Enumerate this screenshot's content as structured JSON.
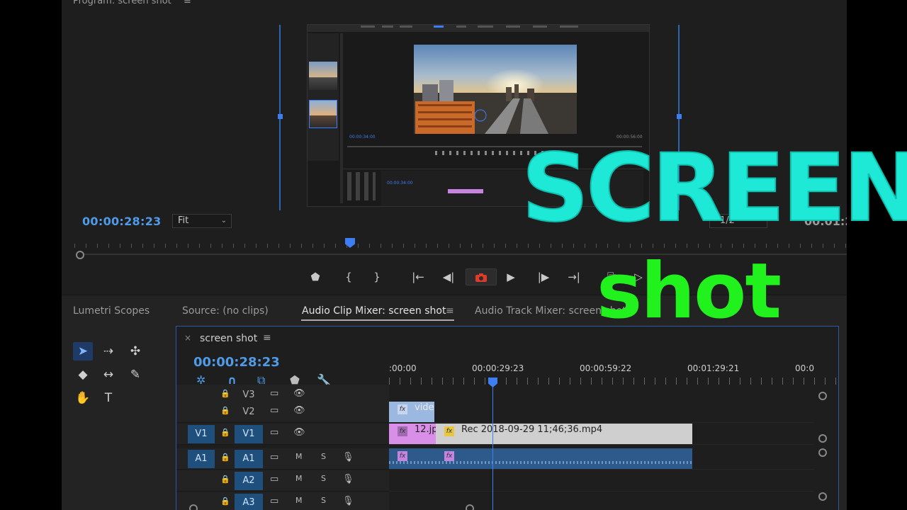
{
  "program_monitor": {
    "title": "Program: screen shot",
    "menu": "≡",
    "timecode": "00:00:28:23",
    "fit_select": "Fit",
    "fit_chevron": "⌄",
    "resolution_select": "1/2",
    "duration_tc": "00:01:2",
    "controls": {
      "marker": "⬟",
      "mark_in": "{",
      "mark_out": "}",
      "go_to_in": "|←",
      "step_back": "◀|",
      "export_frame": "📷",
      "play": "▶",
      "step_forward": "|▶",
      "go_to_out": "→|",
      "insert": "⎘",
      "extract": "▷"
    }
  },
  "nested_screenshot": {
    "timecode_left": "00:00:34:00",
    "timecode_right": "00:00:56:00"
  },
  "tabs": [
    {
      "label": "Lumetri Scopes",
      "active": false
    },
    {
      "label": "Source: (no clips)",
      "active": false
    },
    {
      "label": "Audio Clip Mixer: screen shot",
      "active": true
    },
    {
      "label": "≡",
      "active": false
    },
    {
      "label": "Audio Track Mixer: screen shot",
      "active": false
    }
  ],
  "tools": {
    "selection": "➤",
    "track_select": "⇢",
    "ripple": "✣",
    "razor": "◆",
    "slip": "↔",
    "pen": "✎",
    "hand": "✋",
    "type": "T"
  },
  "timeline": {
    "close": "×",
    "title": "screen shot",
    "menu": "≡",
    "timecode": "00:00:28:23",
    "tool_icons": {
      "nest": "✲",
      "snap": "∩",
      "linked": "⧉",
      "marker": "⬟",
      "settings": "🔧"
    },
    "ruler_labels": [
      ":00:00",
      "00:00:29:23",
      "00:00:59:22",
      "00:01:29:21",
      "00:0"
    ],
    "tracks": [
      {
        "id": "V3",
        "src": "",
        "target": "V3",
        "lock": "🔒",
        "icon1": "▭",
        "icon2": "👁"
      },
      {
        "id": "V2",
        "src": "",
        "target": "V2",
        "lock": "🔒",
        "icon1": "▭",
        "icon2": "👁"
      },
      {
        "id": "V1",
        "src": "V1",
        "target": "V1",
        "lock": "🔒",
        "icon1": "▭",
        "icon2": "👁"
      },
      {
        "id": "A1",
        "src": "A1",
        "target": "A1",
        "lock": "🔒",
        "icon1": "▭",
        "m": "M",
        "s": "S",
        "mic": "🎙"
      },
      {
        "id": "A2",
        "src": "",
        "target": "A2",
        "lock": "🔒",
        "icon1": "▭",
        "m": "M",
        "s": "S",
        "mic": "🎙"
      },
      {
        "id": "A3",
        "src": "",
        "target": "A3",
        "lock": "🔒",
        "icon1": "▭",
        "m": "M",
        "s": "S",
        "mic": "🎙"
      }
    ],
    "clips": {
      "v2_clip": "vide",
      "v1_clip_a": "12.jp",
      "v1_clip_b": "Rec 2018-09-29 11;46;36.mp4",
      "fx": "fx"
    }
  },
  "overlay": {
    "line1": "SCREEN",
    "line2": "shot"
  },
  "colors": {
    "accent_blue": "#3d7ef5",
    "timecode_blue": "#4f9be8",
    "overlay_cyan": "#1ee8d6",
    "overlay_green": "#21f21d",
    "clip_pink": "#d98fe8",
    "clip_gray": "#cfcfcf",
    "clip_audio": "#2d5a8a",
    "work_area_red": "#e02a2a"
  }
}
